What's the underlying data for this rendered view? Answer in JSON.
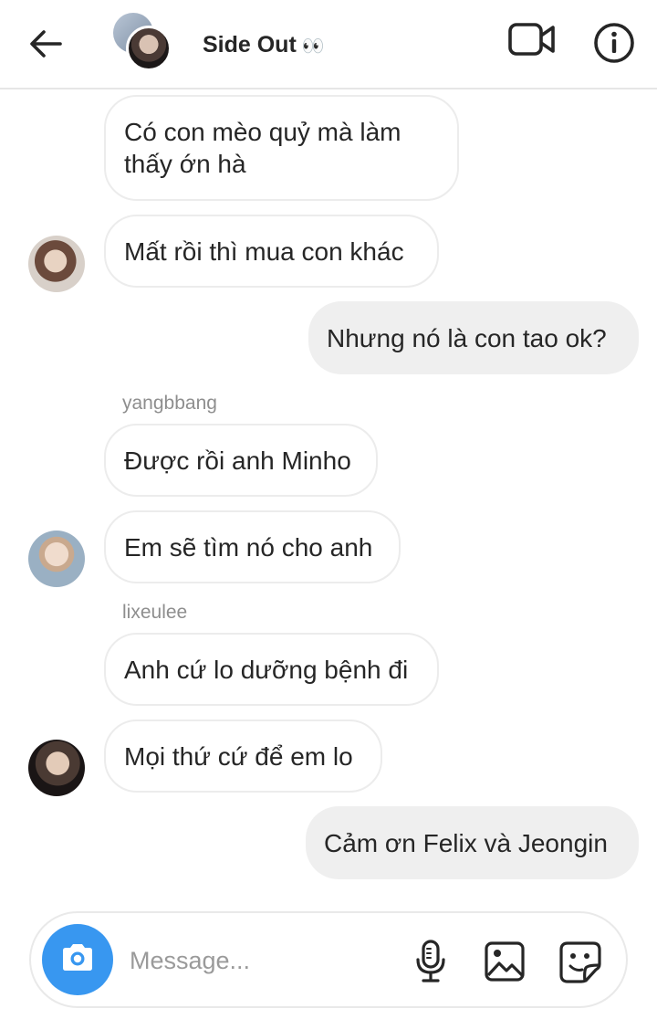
{
  "header": {
    "title": "Side Out",
    "title_emoji": "👀",
    "icons": {
      "back": "back-arrow-icon",
      "video": "video-call-icon",
      "info": "info-icon"
    }
  },
  "messages": [
    {
      "side": "in",
      "text": "Có con mèo quỷ mà làm thấy ớn hà"
    },
    {
      "side": "in",
      "text": "Mất rồi thì mua con khác"
    },
    {
      "side": "out",
      "text": "Nhưng nó là con tao ok?"
    },
    {
      "side": "in",
      "sender": "yangbbang",
      "text": "Được rồi anh Minho"
    },
    {
      "side": "in",
      "text": "Em sẽ tìm nó cho anh"
    },
    {
      "side": "in",
      "sender": "lixeulee",
      "text": "Anh cứ lo dưỡng bệnh đi"
    },
    {
      "side": "in",
      "text": "Mọi thứ cứ để em lo"
    },
    {
      "side": "out",
      "text": "Cảm ơn Felix và Jeongin"
    }
  ],
  "composer": {
    "placeholder": "Message...",
    "icons": {
      "camera": "camera-icon",
      "mic": "microphone-icon",
      "gallery": "gallery-icon",
      "sticker": "sticker-icon"
    }
  },
  "colors": {
    "accent": "#3897f0",
    "outgoing_bubble": "#efefef",
    "incoming_border": "#ececec"
  }
}
